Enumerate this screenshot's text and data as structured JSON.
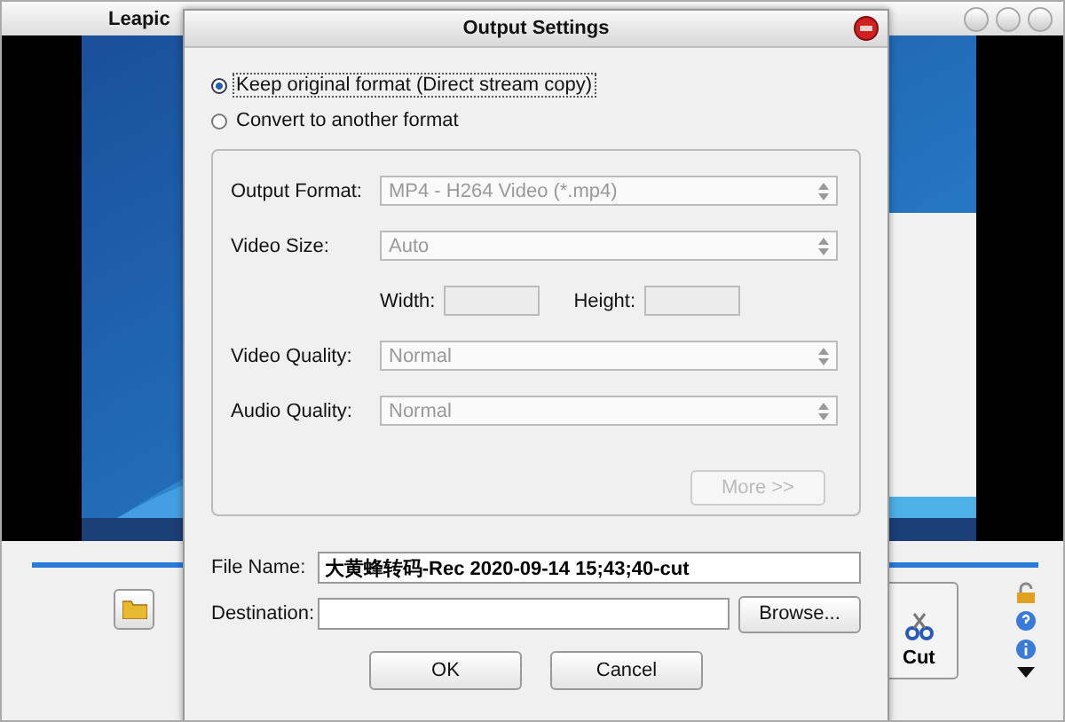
{
  "window": {
    "title": "Leapic"
  },
  "timeline": {
    "level": 1
  },
  "cut_button": {
    "label": "Cut"
  },
  "dialog": {
    "title": "Output Settings",
    "options": [
      {
        "label": "Keep original format (Direct stream copy)",
        "selected": true
      },
      {
        "label": "Convert to another format",
        "selected": false
      }
    ],
    "settings": [
      {
        "kind": "select",
        "label": "Output Format:",
        "value": "MP4 - H264 Video (*.mp4)",
        "disabled": true
      },
      {
        "kind": "select",
        "label": "Video Size:",
        "value": "Auto",
        "disabled": true
      },
      {
        "kind": "size",
        "width_label": "Width:",
        "height_label": "Height:",
        "disabled": true
      },
      {
        "kind": "select",
        "label": "Video Quality:",
        "value": "Normal",
        "disabled": true
      },
      {
        "kind": "select",
        "label": "Audio Quality:",
        "value": "Normal",
        "disabled": true
      }
    ],
    "more_button": {
      "label": "More >>",
      "disabled": true
    },
    "file_name": {
      "label": "File Name:",
      "value": "大黄蜂转码-Rec 2020-09-14 15;43;40-cut"
    },
    "destination": {
      "label": "Destination:"
    },
    "browse_button": {
      "label": "Browse..."
    },
    "ok_button": {
      "label": "OK"
    },
    "cancel_button": {
      "label": "Cancel"
    }
  }
}
